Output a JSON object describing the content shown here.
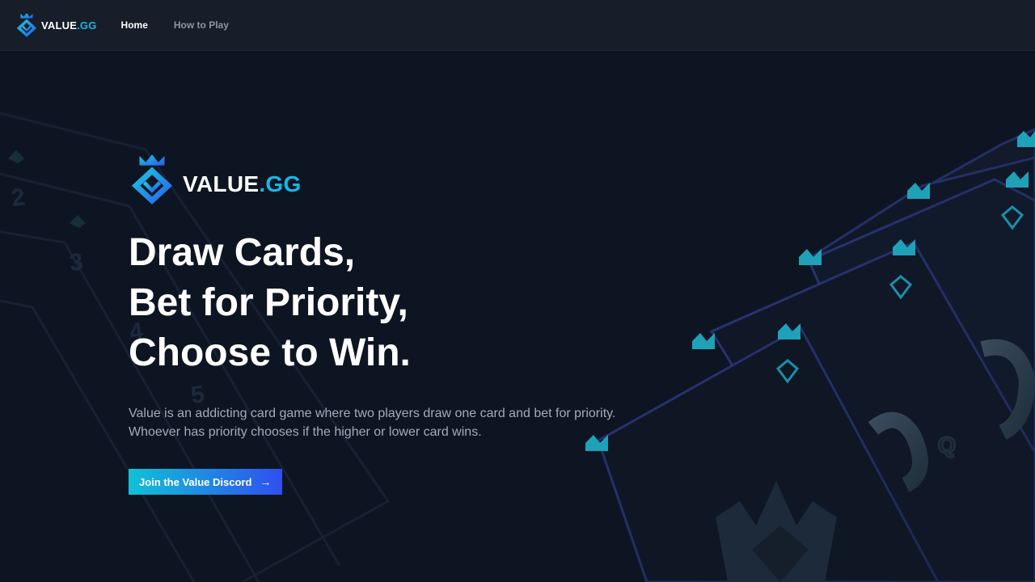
{
  "nav": {
    "logo": {
      "word": "VALUE",
      "suffix": ".GG"
    },
    "links": [
      {
        "label": "Home",
        "active": true
      },
      {
        "label": "How to Play",
        "active": false
      }
    ]
  },
  "hero": {
    "logo": {
      "word": "VALUE",
      "suffix": ".GG"
    },
    "title_lines": [
      "Draw Cards,",
      "Bet for Priority,",
      "Choose to Win."
    ],
    "description_lines": [
      "Value is an addicting card game where two players draw one card and bet for priority.",
      "Whoever has priority chooses if the higher or lower card wins."
    ],
    "cta": {
      "label": "Join the Value Discord",
      "icon": "arrow-right-icon"
    }
  },
  "background": {
    "left_card_ranks": [
      "2",
      "3",
      "4",
      "5"
    ],
    "right_card_rank": "Q"
  },
  "colors": {
    "background": "#0e1522",
    "nav": "#171e2a",
    "accent": "#18b6e6",
    "gradient_start": "#10c2d6",
    "gradient_end": "#2f4ff0",
    "muted_text": "#a3abb8"
  }
}
